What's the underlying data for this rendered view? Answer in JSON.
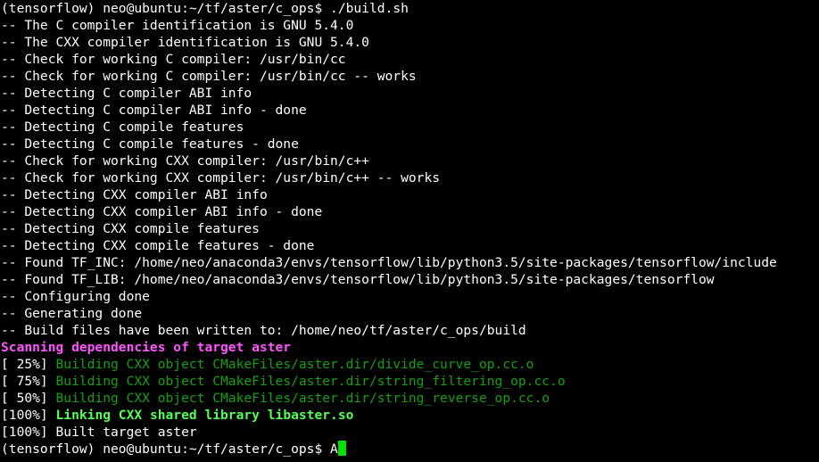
{
  "terminal": {
    "prompt": "(tensorflow) neo@ubuntu:~/tf/aster/c_ops$ ",
    "command": "./build.sh",
    "cmake_lines": [
      "-- The C compiler identification is GNU 5.4.0",
      "-- The CXX compiler identification is GNU 5.4.0",
      "-- Check for working C compiler: /usr/bin/cc",
      "-- Check for working C compiler: /usr/bin/cc -- works",
      "-- Detecting C compiler ABI info",
      "-- Detecting C compiler ABI info - done",
      "-- Detecting C compile features",
      "-- Detecting C compile features - done",
      "-- Check for working CXX compiler: /usr/bin/c++",
      "-- Check for working CXX compiler: /usr/bin/c++ -- works",
      "-- Detecting CXX compiler ABI info",
      "-- Detecting CXX compiler ABI info - done",
      "-- Detecting CXX compile features",
      "-- Detecting CXX compile features - done",
      "-- Found TF_INC: /home/neo/anaconda3/envs/tensorflow/lib/python3.5/site-packages/tensorflow/include",
      "-- Found TF_LIB: /home/neo/anaconda3/envs/tensorflow/lib/python3.5/site-packages/tensorflow",
      "-- Configuring done",
      "-- Generating done",
      "-- Build files have been written to: /home/neo/tf/aster/c_ops/build"
    ],
    "scanning_line": "Scanning dependencies of target aster",
    "build_steps": [
      {
        "percent": "[ 25%] ",
        "text": "Building CXX object CMakeFiles/aster.dir/divide_curve_op.cc.o"
      },
      {
        "percent": "[ 75%] ",
        "text": "Building CXX object CMakeFiles/aster.dir/string_filtering_op.cc.o"
      },
      {
        "percent": "[ 50%] ",
        "text": "Building CXX object CMakeFiles/aster.dir/string_reverse_op.cc.o"
      }
    ],
    "linking_percent": "[100%] ",
    "linking_text": "Linking CXX shared library libaster.so",
    "built_line": "[100%] Built target aster",
    "final_prompt": "(tensorflow) neo@ubuntu:~/tf/aster/c_ops$ ",
    "input_text": "A"
  },
  "colors": {
    "background": "#000000",
    "text": "#ffffff",
    "scanning": "#ff55ff",
    "building": "#13a10e",
    "linking": "#55ff55",
    "cursor": "#00e000"
  }
}
